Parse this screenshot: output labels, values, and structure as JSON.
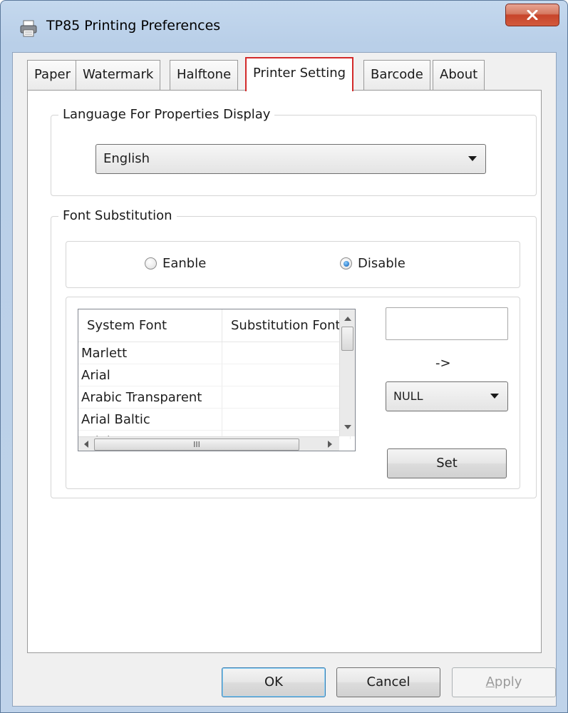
{
  "window": {
    "title": "TP85 Printing Preferences",
    "close_symbol": "x"
  },
  "tabs": [
    {
      "label": "Paper"
    },
    {
      "label": "Watermark"
    },
    {
      "label": "Halftone"
    },
    {
      "label": "Printer Setting",
      "active": true
    },
    {
      "label": "Barcode"
    },
    {
      "label": "About"
    }
  ],
  "language_group": {
    "label": "Language For Properties Display",
    "selected": "English"
  },
  "font_substitution": {
    "label": "Font Substitution",
    "enable_label": "Eanble",
    "disable_label": "Disable",
    "selected_option": "Disable",
    "table": {
      "columns": [
        "System Font",
        "Substitution Font"
      ],
      "rows": [
        [
          "Marlett",
          ""
        ],
        [
          "Arial",
          ""
        ],
        [
          "Arabic Transparent",
          ""
        ],
        [
          "Arial Baltic",
          ""
        ],
        [
          "Arial CE",
          ""
        ]
      ]
    },
    "scroll_grip": "III",
    "arrow_text": "->",
    "substitute_selected": "NULL",
    "set_label": "Set",
    "font_input_value": ""
  },
  "buttons": {
    "ok": "OK",
    "cancel": "Cancel",
    "apply_underlined": "A",
    "apply_rest": "pply"
  },
  "icons": {
    "title": "printer-icon",
    "close": "close-icon"
  }
}
